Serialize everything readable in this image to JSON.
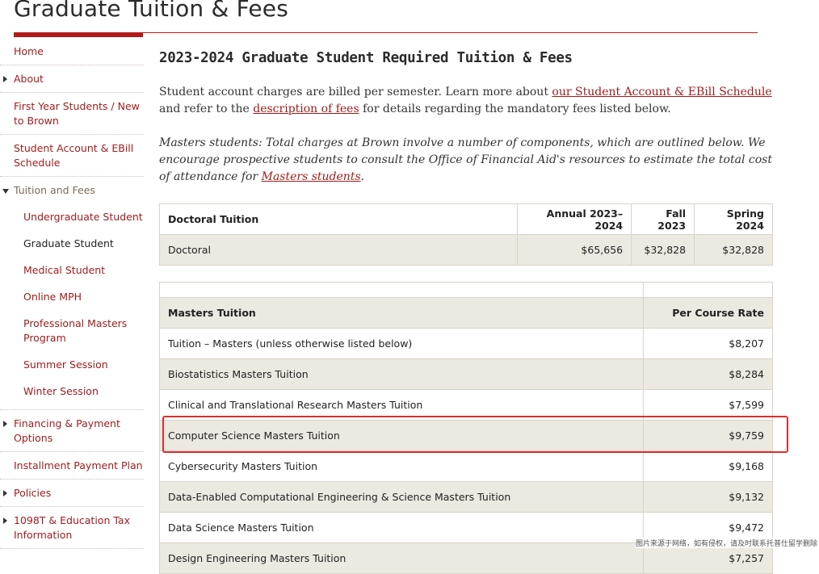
{
  "page": {
    "title": "Graduate Tuition & Fees"
  },
  "sidebar": {
    "items": [
      {
        "label": "Home"
      },
      {
        "label": "About"
      },
      {
        "label": "First Year Students / New to Brown"
      },
      {
        "label": "Student Account & EBill Schedule"
      },
      {
        "label": "Tuition and Fees"
      },
      {
        "label": "Financing & Payment Options"
      },
      {
        "label": "Installment Payment Plan"
      },
      {
        "label": "Policies"
      },
      {
        "label": "1098T & Education Tax Information"
      }
    ],
    "tuition_sub": [
      {
        "label": "Undergraduate Student"
      },
      {
        "label": "Graduate Student"
      },
      {
        "label": "Medical Student"
      },
      {
        "label": "Online MPH"
      },
      {
        "label": "Professional Masters Program"
      },
      {
        "label": "Summer Session"
      },
      {
        "label": "Winter Session"
      }
    ]
  },
  "main": {
    "heading": "2023-2024 Graduate Student Required Tuition & Fees",
    "intro": {
      "part1": "Student account charges are billed per semester. Learn more about ",
      "link1": "our Student Account & EBill Schedule",
      "part2": " and refer to the ",
      "link2": "description of fees",
      "part3": " for details regarding the mandatory fees listed below."
    },
    "masters_note": {
      "text": "Masters students: Total charges at Brown involve a number of components, which are outlined below. We encourage prospective students to consult the Office of Financial Aid's resources to estimate the total cost of attendance for ",
      "link": "Masters students",
      "end": "."
    }
  },
  "doctoral_table": {
    "headers": [
      "Doctoral Tuition",
      "Annual 2023–2024",
      "Fall 2023",
      "Spring 2024"
    ],
    "row": [
      "Doctoral",
      "$65,656",
      "$32,828",
      "$32,828"
    ]
  },
  "masters_table": {
    "headers": [
      "Masters Tuition",
      "Per Course Rate"
    ],
    "rows": [
      [
        "Tuition – Masters (unless otherwise listed below)",
        "$8,207"
      ],
      [
        "Biostatistics Masters Tuition",
        "$8,284"
      ],
      [
        "Clinical and Translational Research Masters Tuition",
        "$7,599"
      ],
      [
        "Computer Science Masters Tuition",
        "$9,759"
      ],
      [
        "Cybersecurity Masters Tuition",
        "$9,168"
      ],
      [
        "Data-Enabled Computational Engineering & Science Masters Tuition",
        "$9,132"
      ],
      [
        "Data Science Masters Tuition",
        "$9,472"
      ],
      [
        "Design Engineering Masters Tuition",
        "$7,257"
      ]
    ],
    "highlighted_row": "Computer Science Masters Tuition"
  },
  "watermark": "图片来源于网络，如有侵权，请及时联系托普仕留学删除",
  "colors": {
    "brand_red": "#9e1b1b",
    "rule_red": "#b31b1b",
    "table_shade": "#ece9e0",
    "highlight_box": "#e02d2d"
  }
}
